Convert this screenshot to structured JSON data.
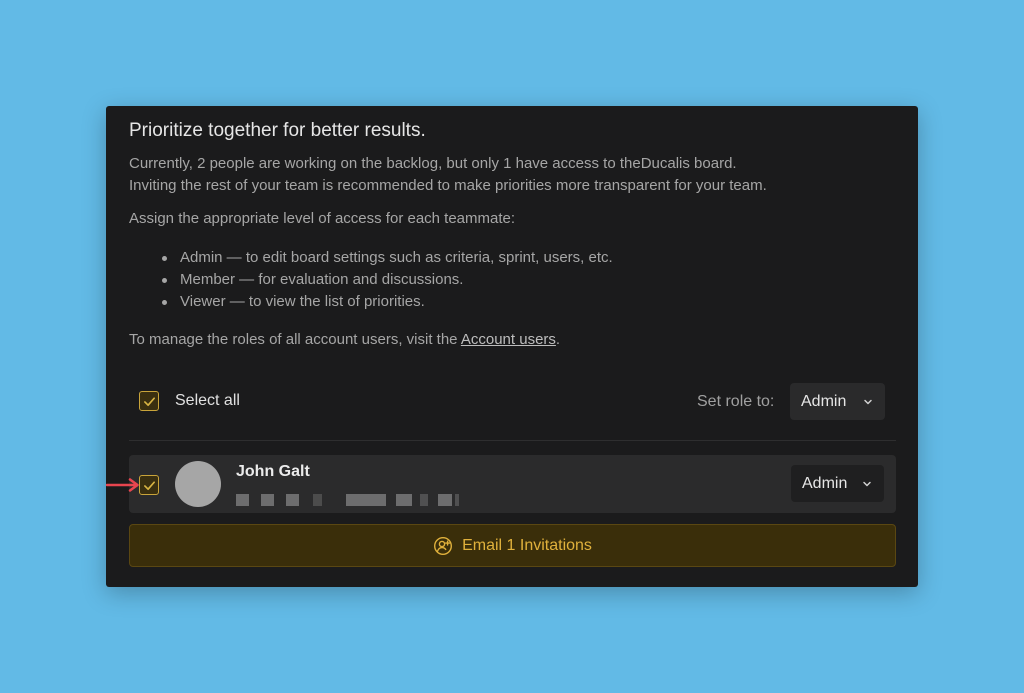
{
  "modal": {
    "title": "Prioritize together for better results.",
    "intro_line1": "Currently, 2 people are working on the backlog, but only 1 have access to theDucalis board.",
    "intro_line2": "Inviting the rest of your team is recommended to make priorities more transparent for your team.",
    "assign_text": "Assign the appropriate level of access for each teammate:",
    "roles": [
      "Admin — to edit board settings such as criteria, sprint, users, etc.",
      "Member — for evaluation and discussions.",
      "Viewer — to view the list of priorities."
    ],
    "manage_prefix": "To manage the roles of all account users, visit the ",
    "manage_link": "Account users",
    "manage_suffix": "."
  },
  "controls": {
    "select_all_label": "Select all",
    "select_all_checked": true,
    "set_role_label": "Set role to:",
    "set_role_value": "Admin"
  },
  "users": [
    {
      "name": "John Galt",
      "checked": true,
      "role": "Admin"
    }
  ],
  "invite_button": {
    "label": "Email 1 Invitations",
    "icon": "add-user-icon"
  },
  "colors": {
    "background": "#62bae6",
    "modal": "#1b1b1c",
    "accent": "#e0b13c",
    "arrow": "#e8454f"
  }
}
